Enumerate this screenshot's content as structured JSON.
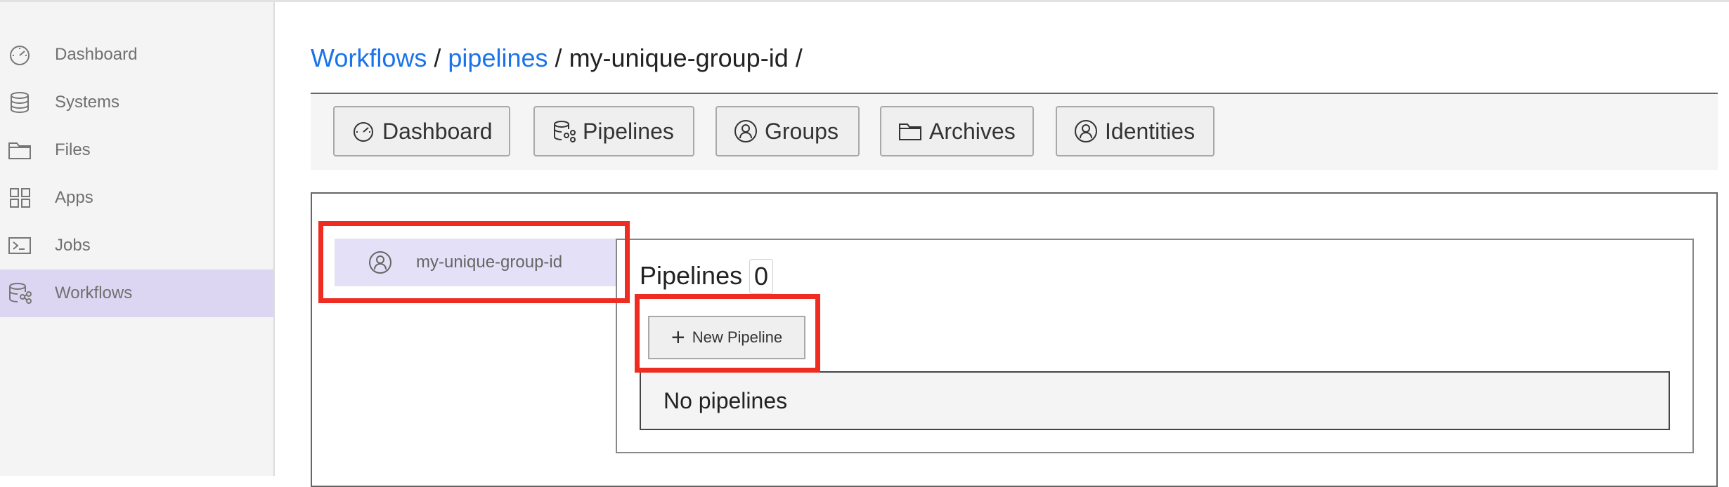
{
  "sidebar": {
    "items": [
      {
        "label": "Dashboard",
        "icon": "gauge-icon"
      },
      {
        "label": "Systems",
        "icon": "database-icon"
      },
      {
        "label": "Files",
        "icon": "folder-icon"
      },
      {
        "label": "Apps",
        "icon": "grid-icon"
      },
      {
        "label": "Jobs",
        "icon": "terminal-icon"
      },
      {
        "label": "Workflows",
        "icon": "workflow-icon",
        "active": true
      }
    ]
  },
  "breadcrumb": {
    "items": [
      {
        "label": "Workflows",
        "link": true
      },
      {
        "label": "pipelines",
        "link": true
      },
      {
        "label": "my-unique-group-id",
        "link": false
      }
    ],
    "separator": "/"
  },
  "toolbar": {
    "buttons": [
      {
        "label": "Dashboard",
        "icon": "gauge-icon"
      },
      {
        "label": "Pipelines",
        "icon": "workflow-icon"
      },
      {
        "label": "Groups",
        "icon": "user-circle-icon"
      },
      {
        "label": "Archives",
        "icon": "folder-icon"
      },
      {
        "label": "Identities",
        "icon": "user-circle-icon"
      }
    ]
  },
  "groups": {
    "items": [
      {
        "label": "my-unique-group-id",
        "icon": "user-circle-icon"
      }
    ]
  },
  "pipelines": {
    "title": "Pipelines",
    "count": "0",
    "new_button": "New Pipeline",
    "empty_message": "No pipelines"
  },
  "colors": {
    "link": "#1a73e8",
    "active_sidebar": "#dcd6f2",
    "group_highlight": "#e4e0f7",
    "annotation": "#ee2c22"
  }
}
